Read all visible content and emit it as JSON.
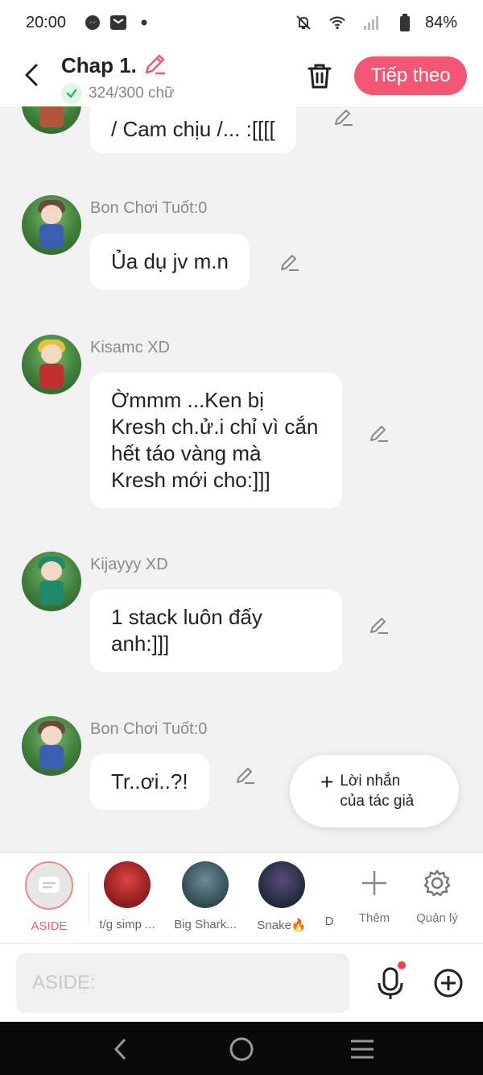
{
  "status_bar": {
    "time": "20:00",
    "battery": "84%"
  },
  "header": {
    "title": "Chap 1.",
    "word_count": "324/300 chữ",
    "next_label": "Tiếp theo"
  },
  "messages": [
    {
      "name": "",
      "text": "/ Cam chịu /... :[[[["
    },
    {
      "name": "Bon Chơi Tuốt:0",
      "text": "Ủa dụ jv m.n"
    },
    {
      "name": "Kisamc XD",
      "text": "Ờmmm ...Ken bị Kresh ch.ử.i chỉ vì cắn hết táo vàng mà Kresh mới cho:]]]"
    },
    {
      "name": "Kijayyy XD",
      "text": "1 stack luôn đấy anh:]]]"
    },
    {
      "name": "Bon Chơi Tuốt:0",
      "text": "Tr..ơi..?!"
    }
  ],
  "author_note": {
    "plus": "+",
    "label": "Lời nhắn của tác giả"
  },
  "characters": [
    {
      "label": "ASIDE"
    },
    {
      "label": "t/g simp ..."
    },
    {
      "label": "Big Shark..."
    },
    {
      "label": "Snake🔥"
    },
    {
      "label": "D"
    }
  ],
  "tools": {
    "add_label": "Thêm",
    "manage_label": "Quản lý"
  },
  "input": {
    "placeholder": "ASIDE:"
  },
  "colors": {
    "accent": "#f55674",
    "background": "#f2f2f2"
  }
}
